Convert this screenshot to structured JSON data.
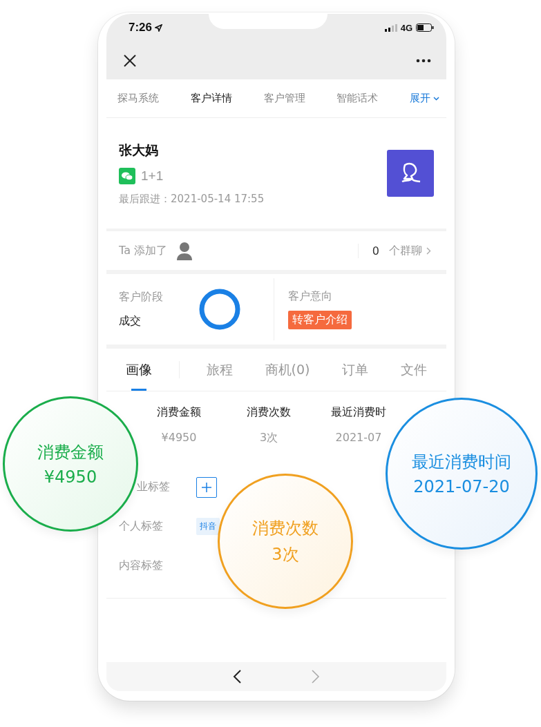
{
  "status_bar": {
    "time": "7:26",
    "network": "4G"
  },
  "top_tabs": [
    {
      "label": "探马系统",
      "selected": false
    },
    {
      "label": "客户详情",
      "selected": true
    },
    {
      "label": "客户管理",
      "selected": false
    },
    {
      "label": "智能话术",
      "selected": false
    }
  ],
  "expand_link": "展开",
  "customer": {
    "name": "张大妈",
    "wechat_name": "1+1",
    "last_follow": "最后跟进：2021-05-14 17:55"
  },
  "groups": {
    "prefix": "Ta 添加了",
    "count": "0",
    "suffix": "个群聊"
  },
  "stage": {
    "label": "客户阶段",
    "value": "成交",
    "intent_label": "客户意向",
    "intent_tag": "转客户介绍"
  },
  "sub_tabs": [
    {
      "label": "画像",
      "selected": true
    },
    {
      "label": "旅程",
      "selected": false
    },
    {
      "label": "商机(0)",
      "selected": false
    },
    {
      "label": "订单",
      "selected": false
    },
    {
      "label": "文件",
      "selected": false
    }
  ],
  "stats": [
    {
      "label": "消费金额",
      "value": "¥4950"
    },
    {
      "label": "消费次数",
      "value": "3次"
    },
    {
      "label": "最近消费时",
      "value": "2021-07"
    }
  ],
  "tags": [
    {
      "label": "业标签",
      "kind": "add"
    },
    {
      "label": "个人标签",
      "kind": "chips",
      "chips": [
        "抖音"
      ]
    },
    {
      "label": "内容标签",
      "kind": "empty"
    }
  ],
  "bubbles": [
    {
      "title": "消费金额",
      "value": "¥4950",
      "color": "#1aad4b"
    },
    {
      "title": "消费次数",
      "value": "3次",
      "color": "#f0a020"
    },
    {
      "title": "最近消费时间",
      "value": "2021-07-20",
      "color": "#1a8ee0"
    }
  ],
  "bottom_nav": {
    "back_enabled": true,
    "forward_enabled": false
  }
}
